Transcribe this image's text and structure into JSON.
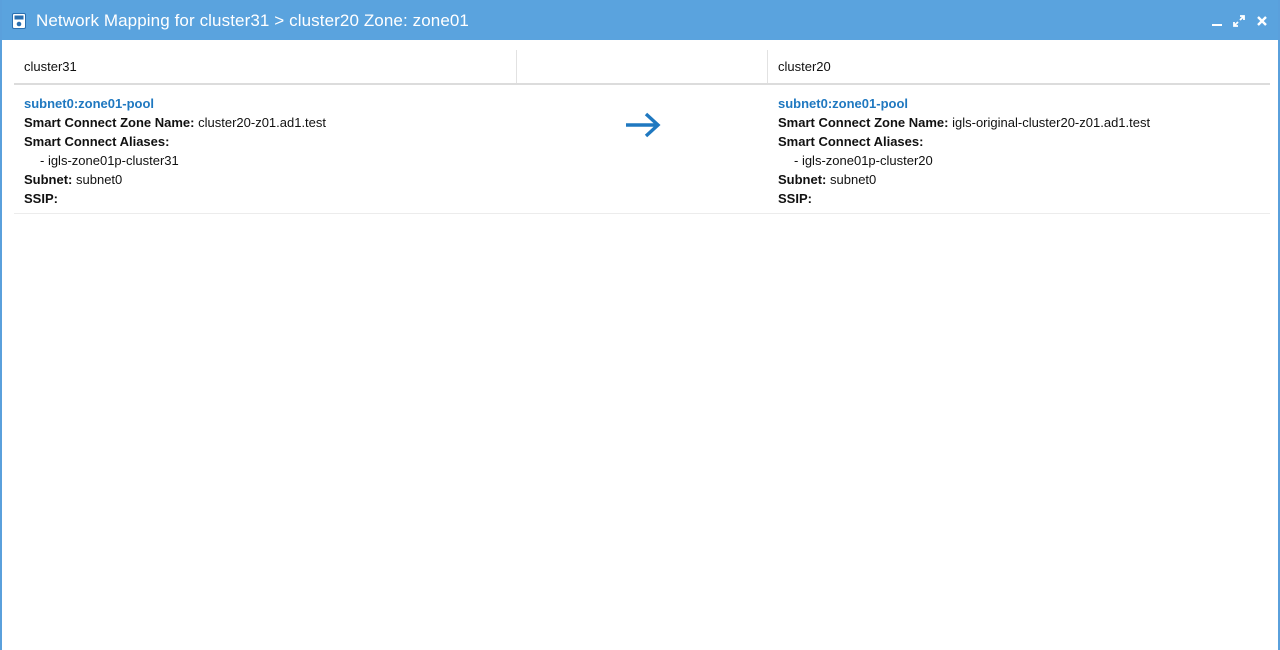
{
  "window": {
    "title": "Network Mapping for cluster31 > cluster20 Zone: zone01",
    "controls": [
      "minimize-icon",
      "restore-icon",
      "close-icon"
    ],
    "accent": "#5aa3de"
  },
  "table": {
    "headers": {
      "left": "cluster31",
      "middle": "",
      "right": "cluster20"
    },
    "row": {
      "left": {
        "pool": "subnet0:zone01-pool",
        "zone_label": "Smart Connect Zone Name:",
        "zone_value": "cluster20-z01.ad1.test",
        "aliases_label": "Smart Connect Aliases:",
        "alias": "- igls-zone01p-cluster31",
        "subnet_label": "Subnet:",
        "subnet_value": "subnet0",
        "ssip_label": "SSIP:",
        "ssip_value": ""
      },
      "arrow_icon": "arrow-right-icon",
      "right": {
        "pool": "subnet0:zone01-pool",
        "zone_label": "Smart Connect Zone Name:",
        "zone_value": "igls-original-cluster20-z01.ad1.test",
        "aliases_label": "Smart Connect Aliases:",
        "alias": "- igls-zone01p-cluster20",
        "subnet_label": "Subnet:",
        "subnet_value": "subnet0",
        "ssip_label": "SSIP:",
        "ssip_value": ""
      }
    }
  },
  "colors": {
    "link": "#1f78c0",
    "arrow": "#1f78c0"
  }
}
